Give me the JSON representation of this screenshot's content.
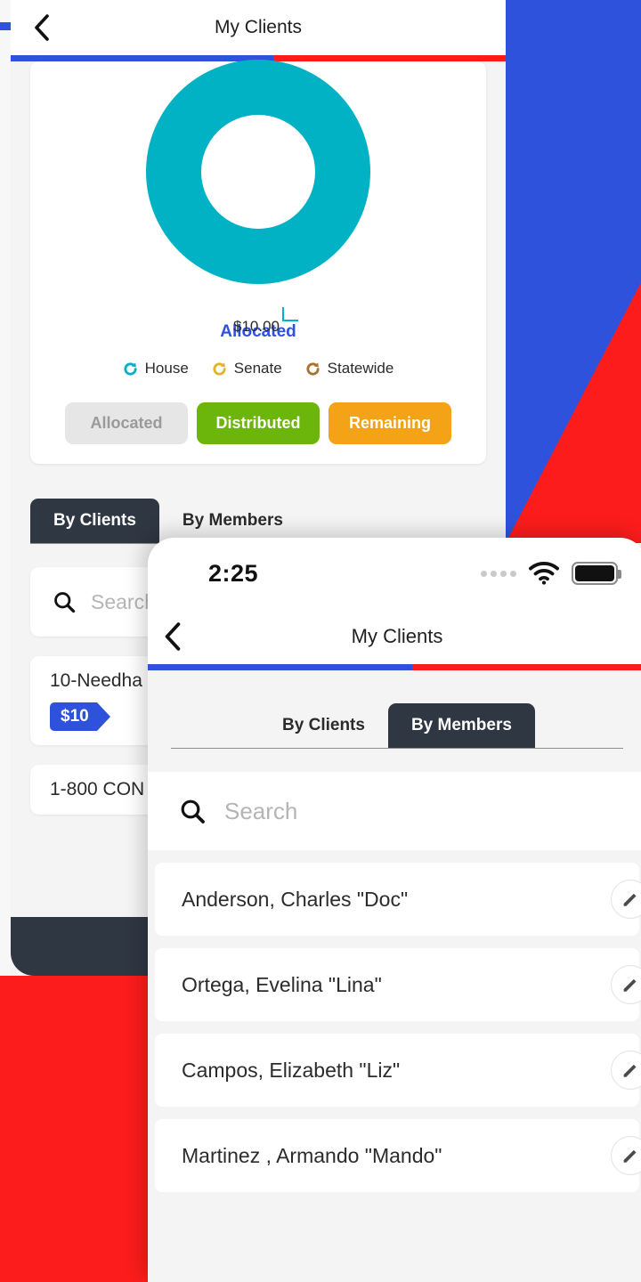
{
  "background": {
    "blue": "#2f52dd",
    "red": "#fc1c1c"
  },
  "window_back": {
    "nav": {
      "back_icon": "chevron-left-icon",
      "title": "My Clients"
    },
    "accent_bar": {
      "left_color": "#2f52dd",
      "right_color": "#fc1c1c"
    },
    "chart_data": {
      "type": "pie",
      "title": "Allocated",
      "categories": [
        "House",
        "Senate",
        "Statewide"
      ],
      "values": [
        10.0,
        0,
        0
      ],
      "colors": [
        "#00b2c4",
        "#e0b42a",
        "#a8722c"
      ],
      "data_labels": [
        "$10.00"
      ],
      "total_label": "$10.00",
      "legend_position": "bottom",
      "donut": true
    },
    "legend": [
      {
        "label": "House",
        "color": "#00b2c4"
      },
      {
        "label": "Senate",
        "color": "#e0b42a"
      },
      {
        "label": "Statewide",
        "color": "#a8722c"
      }
    ],
    "segment_buttons": [
      {
        "label": "Allocated",
        "state": "inactive"
      },
      {
        "label": "Distributed",
        "state": "active-green"
      },
      {
        "label": "Remaining",
        "state": "active-orange"
      }
    ],
    "tabs": [
      {
        "label": "By Clients",
        "active": true
      },
      {
        "label": "By Members",
        "active": false
      }
    ],
    "search": {
      "placeholder": "Search",
      "icon": "search-icon"
    },
    "clients": [
      {
        "name": "10-Needha",
        "amount": "$10"
      },
      {
        "name": "1-800 CON"
      }
    ],
    "bottom_bar": {
      "icon": "location-pin-icon"
    }
  },
  "window_front": {
    "status_bar": {
      "time": "2:25",
      "signal_icon": "signal-dots-icon",
      "wifi_icon": "wifi-icon",
      "battery_icon": "battery-icon"
    },
    "nav": {
      "back_icon": "chevron-left-icon",
      "title": "My Clients"
    },
    "accent_bar": {
      "left_color": "#2f52dd",
      "right_color": "#fc1c1c"
    },
    "tabs": [
      {
        "label": "By Clients",
        "active": false
      },
      {
        "label": "By Members",
        "active": true
      }
    ],
    "search": {
      "placeholder": "Search",
      "icon": "search-icon"
    },
    "members": [
      {
        "name": "Anderson, Charles \"Doc\"",
        "action_icon": "edit-icon"
      },
      {
        "name": "Ortega, Evelina \"Lina\"",
        "action_icon": "edit-icon"
      },
      {
        "name": "Campos, Elizabeth \"Liz\"",
        "action_icon": "edit-icon"
      },
      {
        "name": "Martinez , Armando \"Mando\"",
        "action_icon": "edit-icon"
      }
    ]
  }
}
